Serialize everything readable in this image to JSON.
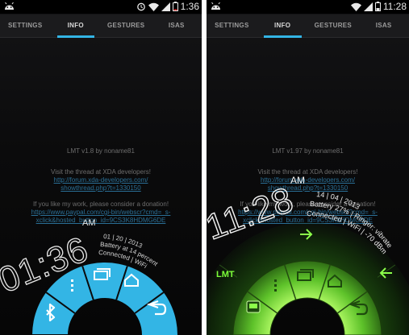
{
  "colors": {
    "accent": "#33b5e5",
    "green_accent": "#7dff3a"
  },
  "left": {
    "status": {
      "time": "1:36",
      "icons": [
        "android-icon",
        "alarm-icon",
        "wifi-icon",
        "signal-icon",
        "battery-icon"
      ]
    },
    "tabs": [
      {
        "label": "SETTINGS"
      },
      {
        "label": "INFO",
        "active": true
      },
      {
        "label": "GESTURES"
      },
      {
        "label": "ISAS"
      }
    ],
    "info": {
      "version": "LMT v1.8 by noname81",
      "thread_text": "Visit the thread at XDA developers!",
      "thread_link_1": "http://forum.xda-developers.com/",
      "thread_link_2": "showthread.php?t=1330150",
      "donate_text": "If you like my work, please consider a donation!",
      "donate_link_1": "https://www.paypal.com/cgi-bin/webscr?cmd=_s-",
      "donate_link_2": "xclick&hosted_button_id=9CS3K8HDMG6DE"
    },
    "pie": {
      "clock": "01:36",
      "ampm": "AM",
      "date": "01 | 20 | 2013",
      "battery": "Battery at 14 percent",
      "connection": "Connected | WiFi",
      "buttons": [
        "bluetooth-icon",
        "menu-icon",
        "recent-apps-icon",
        "home-icon",
        "back-icon"
      ]
    }
  },
  "right": {
    "status": {
      "time": "11:28",
      "icons": [
        "android-icon",
        "wifi-icon",
        "signal-icon",
        "battery-icon"
      ]
    },
    "tabs": [
      {
        "label": "SETTINGS"
      },
      {
        "label": "INFO",
        "active": true
      },
      {
        "label": "GESTURES"
      },
      {
        "label": "ISAS"
      }
    ],
    "info": {
      "version": "LMT v1.97 by noname81",
      "thread_text": "Visit the thread at XDA developers!",
      "thread_link_1": "http://forum.xda-developers.com/",
      "thread_link_2": "showthread.php?t=1330150",
      "donate_text": "If you like my work, please consider a donation!",
      "donate_link_1": "https://www.paypal.com/cgi-bin/webscr?cmd=_s-",
      "donate_link_2": "xclick&hosted_button_id=9CS3K8HDMG6DE"
    },
    "pie": {
      "clock": "11:28",
      "ampm": "AM",
      "date": "14 | 04 | 2013",
      "battery": "Battery 27% | Ringer: vibrate",
      "connection": "Connected | WiFi | -70 dBm",
      "label": "LMT",
      "buttons": [
        "screenshot-icon",
        "menu-icon",
        "recent-apps-icon",
        "home-icon",
        "back-icon"
      ],
      "outer_arrows": [
        "arrow-right-icon",
        "arrow-left-icon"
      ]
    }
  }
}
